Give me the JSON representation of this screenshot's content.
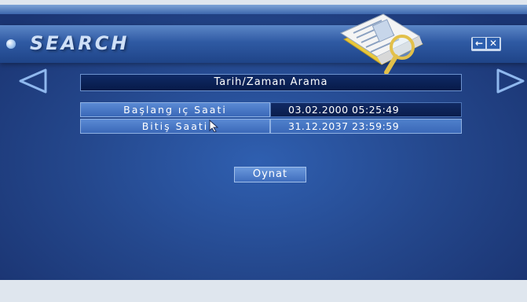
{
  "header": {
    "title": "SEARCH",
    "window_controls": {
      "back_label": "←",
      "close_label": "✕"
    }
  },
  "panel": {
    "title": "Tarih/Zaman Arama",
    "rows": [
      {
        "label": "Başlang ıç Saati",
        "value": "03.02.2000 05:25:49"
      },
      {
        "label": "Bitiş Saati",
        "value": "31.12.2037 23:59:59"
      }
    ],
    "play_label": "Oynat"
  },
  "icons": {
    "title_dot": "bullet-dot-icon",
    "document": "document-magnifier-icon",
    "nav_left": "left-arrow-icon",
    "nav_right": "right-arrow-icon",
    "cursor": "mouse-pointer-icon"
  },
  "colors": {
    "background": "#24478c",
    "header": "#2f5aa3",
    "panel_title_bg": "#0f2a66",
    "row_bg": "#3a68b8",
    "accent": "#cfe0f7"
  }
}
